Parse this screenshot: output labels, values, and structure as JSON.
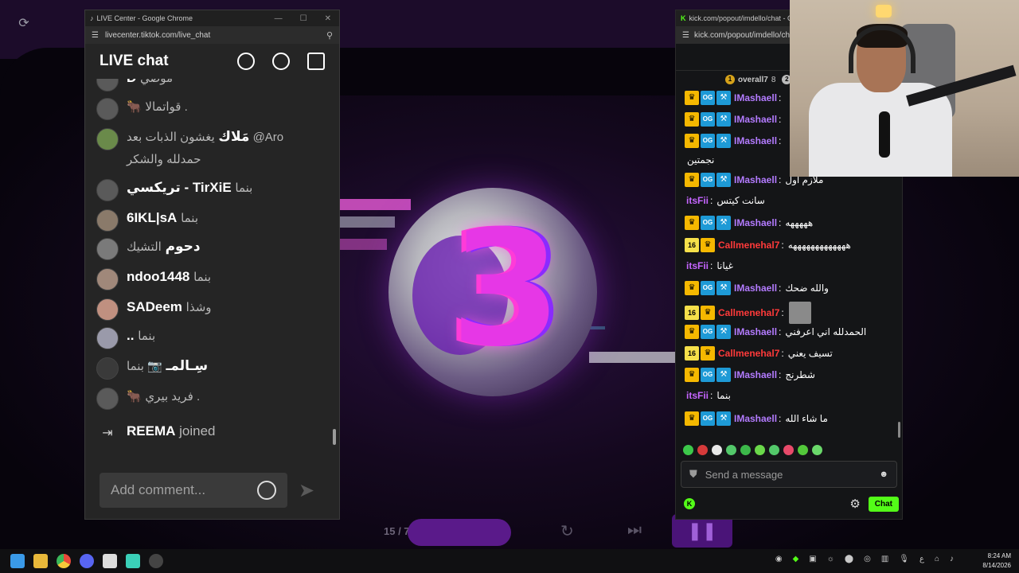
{
  "tiktok_window": {
    "tab_title": "LIVE Center - Google Chrome",
    "url": "livecenter.tiktok.com/live_chat",
    "header_title": "LIVE chat",
    "comments": [
      {
        "name": "D",
        "message": "موضي"
      },
      {
        "name": "قواتمالا .",
        "message": "🐂"
      },
      {
        "name": "مَلاك",
        "message": "يغشون الذبات بعد @Aro",
        "line2": "حمدلله والشكر"
      },
      {
        "name": "تريكسي - TirXiE",
        "message": "بنما"
      },
      {
        "name": "6IKL|sA",
        "message": "بنما"
      },
      {
        "name": "دحوم",
        "message": "التشيك"
      },
      {
        "name": "ndoo1448",
        "message": "بنما"
      },
      {
        "name": "SADeem",
        "message": "وشذا"
      },
      {
        "name": "..",
        "message": "بنما"
      },
      {
        "name": "سِـالمـ",
        "message": "📷 بنما"
      },
      {
        "name": "فريد بيري .",
        "message": "🐂"
      }
    ],
    "join_event": {
      "name": "REEMA",
      "text": "joined"
    },
    "comment_placeholder": "Add comment..."
  },
  "kick_window": {
    "tab_title": "kick.com/popout/imdello/chat - Go",
    "url": "kick.com/popout/imdello/ch",
    "chat_heading": "Ch",
    "leaderboard": [
      {
        "rank": "1",
        "name": "overall7",
        "score": "8"
      },
      {
        "rank": "2"
      }
    ],
    "messages": [
      {
        "user": "IMashaell",
        "text": "",
        "badges": [
          "crown",
          "og",
          "mod"
        ],
        "color": "im"
      },
      {
        "user": "IMashaell",
        "text": "",
        "badges": [
          "crown",
          "og",
          "mod"
        ],
        "color": "im"
      },
      {
        "user": "IMashaell",
        "text": "",
        "badges": [
          "crown",
          "og",
          "mod"
        ],
        "color": "im"
      },
      {
        "user": "",
        "text": "نجمتين",
        "badges": [],
        "color": ""
      },
      {
        "user": "IMashaell",
        "text": "ملازم اول",
        "badges": [
          "crown",
          "og",
          "mod"
        ],
        "color": "im"
      },
      {
        "user": "itsFii",
        "text": "سانت كيتس",
        "badges": [],
        "color": "it"
      },
      {
        "user": "IMashaell",
        "text": "هههههه",
        "badges": [
          "crown",
          "og",
          "mod"
        ],
        "color": "im"
      },
      {
        "user": "Callmenehal7",
        "text": "هههههههههههههه",
        "badges": [
          "sub",
          "crown"
        ],
        "color": "ca"
      },
      {
        "user": "itsFii",
        "text": "غيانا",
        "badges": [],
        "color": "it"
      },
      {
        "user": "IMashaell",
        "text": "والله ضحك",
        "badges": [
          "crown",
          "og",
          "mod"
        ],
        "color": "im"
      },
      {
        "user": "Callmenehal7",
        "text": "",
        "badges": [
          "sub",
          "crown"
        ],
        "color": "ca",
        "emote": true
      },
      {
        "user": "IMashaell",
        "text": "الحمدلله اني اعرفني",
        "badges": [
          "crown",
          "og",
          "mod"
        ],
        "color": "im"
      },
      {
        "user": "Callmenehal7",
        "text": "تسيف يعني",
        "badges": [
          "sub",
          "crown"
        ],
        "color": "ca"
      },
      {
        "user": "IMashaell",
        "text": "شطرنج",
        "badges": [
          "crown",
          "og",
          "mod"
        ],
        "color": "im"
      },
      {
        "user": "itsFii",
        "text": "بنما",
        "badges": [],
        "color": "it"
      },
      {
        "user": "IMashaell",
        "text": "ما شاء الله",
        "badges": [
          "crown",
          "og",
          "mod"
        ],
        "color": "im"
      }
    ],
    "sub_badge_text": "16",
    "input_placeholder": "Send a message",
    "chat_button": "Chat"
  },
  "player": {
    "page": "15 / 7",
    "countdown_digit": "3"
  },
  "taskbar": {
    "time": "8:24 AM",
    "date": "8/14/2026",
    "lang": "ع"
  },
  "colors": {
    "kick_green": "#53fc18",
    "accent_purple": "#5a1a8a",
    "crown_gold": "#f5b800"
  }
}
